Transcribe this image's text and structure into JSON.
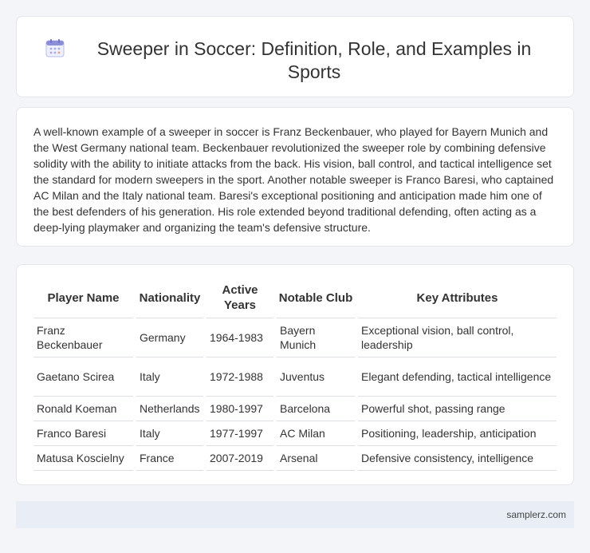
{
  "header": {
    "title": "Sweeper in Soccer: Definition, Role, and Examples in Sports",
    "icon": "calendar-icon"
  },
  "intro": {
    "text": "A well-known example of a sweeper in soccer is Franz Beckenbauer, who played for Bayern Munich and the West Germany national team. Beckenbauer revolutionized the sweeper role by combining defensive solidity with the ability to initiate attacks from the back. His vision, ball control, and tactical intelligence set the standard for modern sweepers in the sport. Another notable sweeper is Franco Baresi, who captained AC Milan and the Italy national team. Baresi's exceptional positioning and anticipation made him one of the best defenders of his generation. His role extended beyond traditional defending, often acting as a deep-lying playmaker and organizing the team's defensive structure."
  },
  "table": {
    "headers": [
      "Player Name",
      "Nationality",
      "Active Years",
      "Notable Club",
      "Key Attributes"
    ],
    "rows": [
      [
        "Franz Beckenbauer",
        "Germany",
        "1964-1983",
        "Bayern Munich",
        "Exceptional vision, ball control, leadership"
      ],
      [
        "Gaetano Scirea",
        "Italy",
        "1972-1988",
        "Juventus",
        "Elegant defending, tactical intelligence"
      ],
      [
        "Ronald Koeman",
        "Netherlands",
        "1980-1997",
        "Barcelona",
        "Powerful shot, passing range"
      ],
      [
        "Franco Baresi",
        "Italy",
        "1977-1997",
        "AC Milan",
        "Positioning, leadership, anticipation"
      ],
      [
        "Matusa Koscielny",
        "France",
        "2007-2019",
        "Arsenal",
        "Defensive consistency, intelligence"
      ]
    ]
  },
  "footer": {
    "text": "samplerz.com"
  },
  "colors": {
    "background": "#f4f5f9",
    "card": "#ffffff",
    "footer": "#e8edf6",
    "icon_accent": "#8a8fd8"
  }
}
